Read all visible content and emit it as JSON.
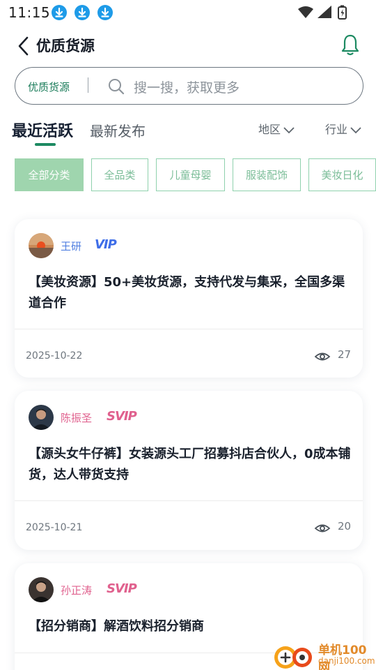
{
  "status_bar": {
    "time": "11:15"
  },
  "header": {
    "title": "优质货源"
  },
  "search": {
    "scope": "优质货源",
    "placeholder": "搜一搜，获取更多"
  },
  "tabs": [
    {
      "label": "最近活跃",
      "active": true
    },
    {
      "label": "最新发布",
      "active": false
    }
  ],
  "filters": {
    "region": "地区",
    "industry": "行业"
  },
  "categories": [
    {
      "label": "全部分类",
      "active": true
    },
    {
      "label": "全品类",
      "active": false
    },
    {
      "label": "儿童母婴",
      "active": false
    },
    {
      "label": "服装配饰",
      "active": false
    },
    {
      "label": "美妆日化",
      "active": false
    }
  ],
  "posts": [
    {
      "author": "王研",
      "badge": "VIP",
      "title": "【美妆资源】50+美妆货源，支持代发与集采，全国多渠道合作",
      "date": "2025-10-22",
      "views": "27"
    },
    {
      "author": "陈振圣",
      "badge": "SVIP",
      "title": "【源头女牛仔裤】女装源头工厂招募抖店合伙人，0成本铺货，达人带货支持",
      "date": "2025-10-21",
      "views": "20"
    },
    {
      "author": "孙正涛",
      "badge": "SVIP",
      "title": "【招分销商】解酒饮料招分销商",
      "date": "",
      "views": ""
    }
  ],
  "watermark": {
    "name": "单机100网",
    "site": "danji100.com"
  },
  "colors": {
    "accent": "#1d8a62",
    "chip_active": "#9fd5ae",
    "vip": "#3f6ee8",
    "svip": "#e0618e",
    "download": "#1e9be8"
  }
}
